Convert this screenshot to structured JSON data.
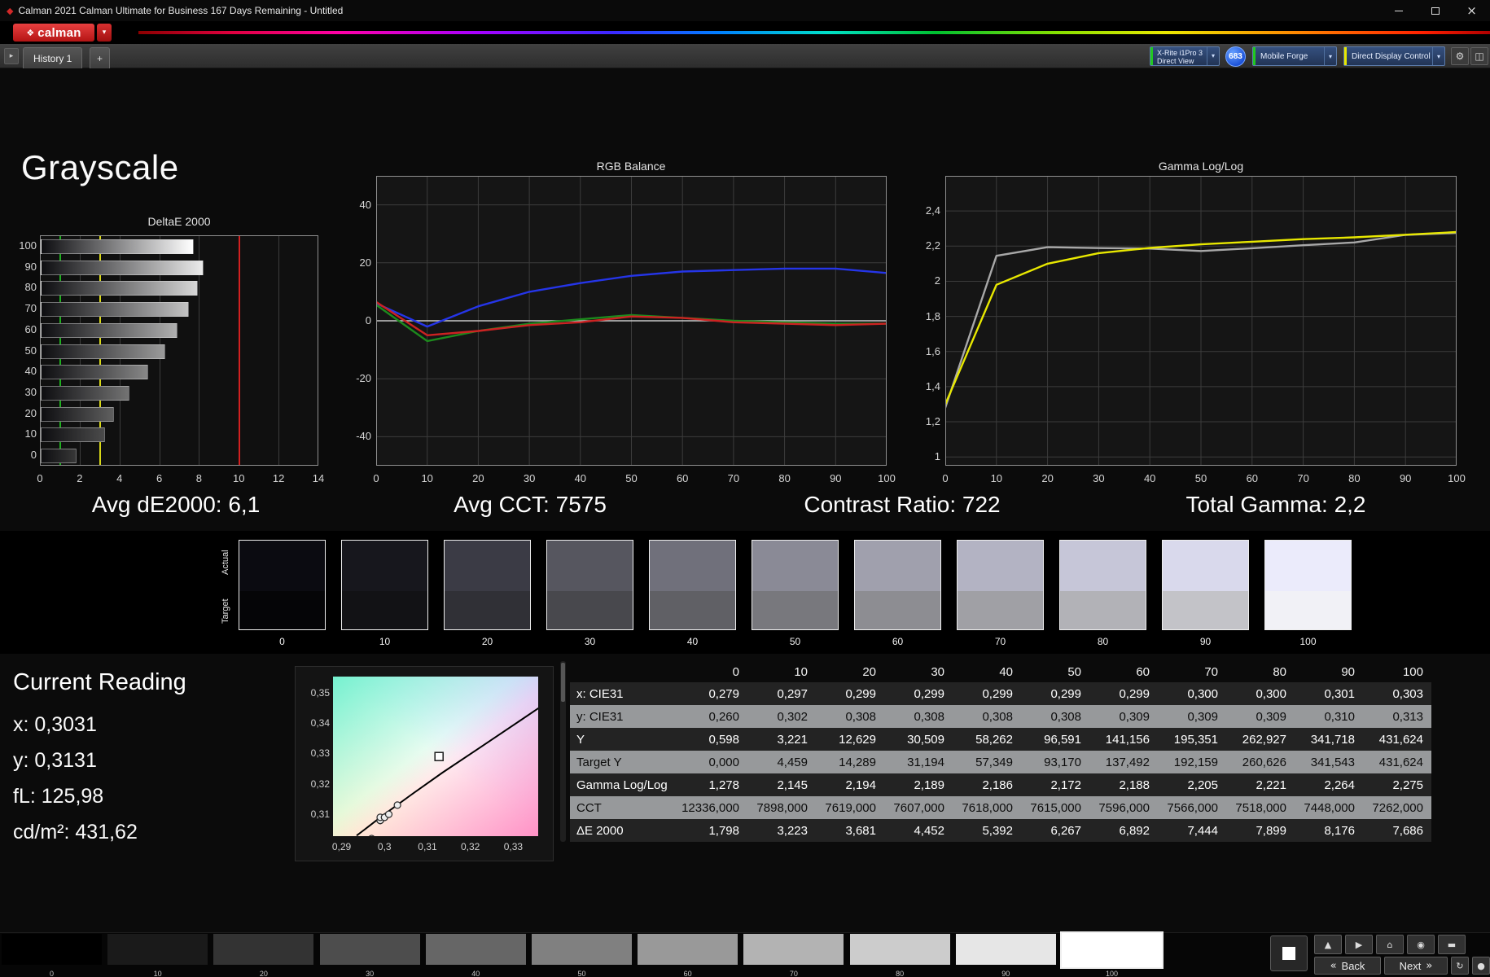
{
  "window": {
    "title": "Calman 2021 Calman Ultimate for Business 167 Days Remaining  - Untitled"
  },
  "icons": {
    "app_diamond": "◆",
    "logo_diamond": "❖",
    "close": "×",
    "dropdown_arrow": "▾",
    "caret_right": "▸",
    "gear": "⚙",
    "layout": "◫"
  },
  "toolbar": {
    "logo_text": "calman",
    "meter": {
      "line1": "X-Rite i1Pro 3",
      "line2": "Direct View"
    },
    "badge": "683",
    "source": "Mobile Forge",
    "display": "Direct Display Control"
  },
  "tabs": {
    "active": "History 1",
    "add": "+"
  },
  "page": {
    "title": "Grayscale"
  },
  "stats": {
    "avg_de2000": "Avg dE2000: 6,1",
    "avg_cct": "Avg CCT: 7575",
    "contrast_ratio": "Contrast Ratio: 722",
    "total_gamma": "Total Gamma: 2,2"
  },
  "chart_data": [
    {
      "id": "deltae2000",
      "type": "bar",
      "orientation": "horizontal",
      "title": "DeltaE 2000",
      "categories": [
        100,
        90,
        80,
        70,
        60,
        50,
        40,
        30,
        20,
        10,
        0
      ],
      "values": [
        7.686,
        8.176,
        7.899,
        7.444,
        6.892,
        6.267,
        5.392,
        4.452,
        3.681,
        3.223,
        1.798
      ],
      "xlim": [
        0,
        14
      ],
      "xticks": [
        0,
        2,
        4,
        6,
        8,
        10,
        12,
        14
      ],
      "xtick_labels": [
        "0",
        "2",
        "4",
        "6",
        "8",
        "10",
        "12",
        "14"
      ],
      "reference_lines": [
        {
          "x": 1,
          "color": "#1fae1f"
        },
        {
          "x": 3,
          "color": "#d8d818"
        },
        {
          "x": 10,
          "color": "#d22020"
        }
      ]
    },
    {
      "id": "rgb_balance",
      "type": "line",
      "title": "RGB Balance",
      "x": [
        0,
        10,
        20,
        30,
        40,
        50,
        60,
        70,
        80,
        90,
        100
      ],
      "xticks": [
        0,
        10,
        20,
        30,
        40,
        50,
        60,
        70,
        80,
        90,
        100
      ],
      "xtick_labels": [
        "0",
        "10",
        "20",
        "30",
        "40",
        "50",
        "60",
        "70",
        "80",
        "90",
        "100"
      ],
      "ylim": [
        -50,
        50
      ],
      "yticks": [
        40,
        20,
        0,
        -20,
        -40
      ],
      "ytick_labels": [
        "40",
        "20",
        "0",
        "-20",
        "-40"
      ],
      "zero_line": true,
      "series": [
        {
          "name": "Blue",
          "color": "#2535e8",
          "values": [
            6,
            -2,
            5,
            10,
            13,
            15.5,
            17,
            17.5,
            18,
            18,
            16.5
          ]
        },
        {
          "name": "Green",
          "color": "#1d8a1d",
          "values": [
            5.5,
            -7,
            -3.5,
            -1,
            0.5,
            2,
            1,
            0,
            -0.5,
            -1,
            -1
          ]
        },
        {
          "name": "Red",
          "color": "#cc2222",
          "values": [
            6.5,
            -5,
            -3.5,
            -1.5,
            -0.5,
            1.5,
            1,
            -0.5,
            -1,
            -1.5,
            -1
          ]
        }
      ]
    },
    {
      "id": "gamma_log_log",
      "type": "line",
      "title": "Gamma Log/Log",
      "x": [
        0,
        10,
        20,
        30,
        40,
        50,
        60,
        70,
        80,
        90,
        100
      ],
      "xticks": [
        0,
        10,
        20,
        30,
        40,
        50,
        60,
        70,
        80,
        90,
        100
      ],
      "xtick_labels": [
        "0",
        "10",
        "20",
        "30",
        "40",
        "50",
        "60",
        "70",
        "80",
        "90",
        "100"
      ],
      "ylim": [
        0.95,
        2.6
      ],
      "yticks": [
        2.4,
        2.2,
        2.0,
        1.8,
        1.6,
        1.4,
        1.2,
        1.0
      ],
      "ytick_labels": [
        "2,4",
        "2,2",
        "2",
        "1,8",
        "1,6",
        "1,4",
        "1,2",
        "1"
      ],
      "zero_line": false,
      "series": [
        {
          "name": "Gamma measured",
          "color": "#a8a8a8",
          "values": [
            1.28,
            2.145,
            2.194,
            2.189,
            2.186,
            2.172,
            2.188,
            2.205,
            2.221,
            2.264,
            2.275
          ]
        },
        {
          "name": "Gamma trend",
          "color": "#e8e800",
          "values": [
            1.3,
            1.98,
            2.1,
            2.16,
            2.19,
            2.21,
            2.225,
            2.24,
            2.25,
            2.265,
            2.28
          ]
        }
      ]
    },
    {
      "id": "cie_chromaticity",
      "type": "scatter",
      "xlim": [
        0.288,
        0.3358
      ],
      "ylim": [
        0.3028,
        0.3553
      ],
      "xtick_values": [
        0.29,
        0.3,
        0.31,
        0.32,
        0.33
      ],
      "xtick_labels": [
        "0,29",
        "0,3",
        "0,31",
        "0,32",
        "0,33"
      ],
      "ytick_values": [
        0.35,
        0.34,
        0.33,
        0.32,
        0.31
      ],
      "ytick_labels": [
        "0,35",
        "0,34",
        "0,33",
        "0,32",
        "0,31"
      ],
      "target": {
        "x": 0.3127,
        "y": 0.329
      },
      "points": [
        [
          0.297,
          0.302
        ],
        [
          0.299,
          0.308
        ],
        [
          0.299,
          0.308
        ],
        [
          0.299,
          0.308
        ],
        [
          0.299,
          0.308
        ],
        [
          0.299,
          0.309
        ],
        [
          0.3,
          0.309
        ],
        [
          0.3,
          0.309
        ],
        [
          0.301,
          0.31
        ],
        [
          0.303,
          0.313
        ]
      ],
      "locus": [
        [
          0.2935,
          0.303
        ],
        [
          0.2952,
          0.3048
        ],
        [
          0.2996,
          0.3096
        ],
        [
          0.3064,
          0.3166
        ],
        [
          0.3135,
          0.3237
        ],
        [
          0.3221,
          0.3318
        ],
        [
          0.3319,
          0.3411
        ],
        [
          0.3365,
          0.3455
        ]
      ]
    }
  ],
  "current_reading": {
    "title": "Current Reading",
    "lines": [
      "x: 0,3031",
      "y: 0,3131",
      "fL: 125,98",
      "cd/m²: 431,62"
    ]
  },
  "swatches": {
    "actual_label": "Actual",
    "target_label": "Target",
    "levels": [
      "0",
      "10",
      "20",
      "30",
      "40",
      "50",
      "60",
      "70",
      "80",
      "90",
      "100"
    ],
    "actual_colors": [
      "#0b0b11",
      "#17171d",
      "#3b3b45",
      "#56565f",
      "#70707b",
      "#8a8a96",
      "#a0a0ad",
      "#b3b3c3",
      "#c6c6d8",
      "#d9d9ec",
      "#ebebfb"
    ],
    "target_colors": [
      "#050507",
      "#121215",
      "#303036",
      "#48484d",
      "#606065",
      "#78787d",
      "#8d8d92",
      "#a0a0a5",
      "#b2b2b7",
      "#c3c3c8",
      "#f1f1f6"
    ]
  },
  "table": {
    "columns": [
      "0",
      "10",
      "20",
      "30",
      "40",
      "50",
      "60",
      "70",
      "80",
      "90",
      "100"
    ],
    "rows": [
      {
        "label": "x: CIE31",
        "values": [
          "0,279",
          "0,297",
          "0,299",
          "0,299",
          "0,299",
          "0,299",
          "0,299",
          "0,300",
          "0,300",
          "0,301",
          "0,303"
        ]
      },
      {
        "label": "y: CIE31",
        "values": [
          "0,260",
          "0,302",
          "0,308",
          "0,308",
          "0,308",
          "0,308",
          "0,309",
          "0,309",
          "0,309",
          "0,310",
          "0,313"
        ]
      },
      {
        "label": "Y",
        "values": [
          "0,598",
          "3,221",
          "12,629",
          "30,509",
          "58,262",
          "96,591",
          "141,156",
          "195,351",
          "262,927",
          "341,718",
          "431,624"
        ]
      },
      {
        "label": "Target Y",
        "values": [
          "0,000",
          "4,459",
          "14,289",
          "31,194",
          "57,349",
          "93,170",
          "137,492",
          "192,159",
          "260,626",
          "341,543",
          "431,624"
        ]
      },
      {
        "label": "Gamma Log/Log",
        "values": [
          "1,278",
          "2,145",
          "2,194",
          "2,189",
          "2,186",
          "2,172",
          "2,188",
          "2,205",
          "2,221",
          "2,264",
          "2,275"
        ]
      },
      {
        "label": "CCT",
        "values": [
          "12336,000",
          "7898,000",
          "7619,000",
          "7607,000",
          "7618,000",
          "7615,000",
          "7596,000",
          "7566,000",
          "7518,000",
          "7448,000",
          "7262,000"
        ]
      },
      {
        "label": "ΔE 2000",
        "values": [
          "1,798",
          "3,223",
          "3,681",
          "4,452",
          "5,392",
          "6,267",
          "6,892",
          "7,444",
          "7,899",
          "8,176",
          "7,686"
        ]
      }
    ]
  },
  "bottom_strip": {
    "levels": [
      "0",
      "10",
      "20",
      "30",
      "40",
      "50",
      "60",
      "70",
      "80",
      "90",
      "100"
    ],
    "colors": [
      "#000000",
      "#1a1a1a",
      "#333333",
      "#4d4d4d",
      "#666666",
      "#808080",
      "#999999",
      "#b3b3b3",
      "#cccccc",
      "#e6e6e6",
      "#ffffff"
    ],
    "selected_index": 10
  },
  "transport": {
    "buttons_top": [
      {
        "name": "up",
        "glyph": "▲"
      },
      {
        "name": "play",
        "glyph": "▶"
      },
      {
        "name": "home",
        "glyph": "⌂"
      },
      {
        "name": "target",
        "glyph": "◉"
      },
      {
        "name": "pattern-bar",
        "glyph": "▬"
      }
    ],
    "back": {
      "icon": "«",
      "label": "Back"
    },
    "next": {
      "icon": "»",
      "label": "Next"
    },
    "buttons_extra": [
      {
        "name": "refresh",
        "glyph": "↻"
      },
      {
        "name": "record",
        "glyph": "●"
      }
    ]
  }
}
